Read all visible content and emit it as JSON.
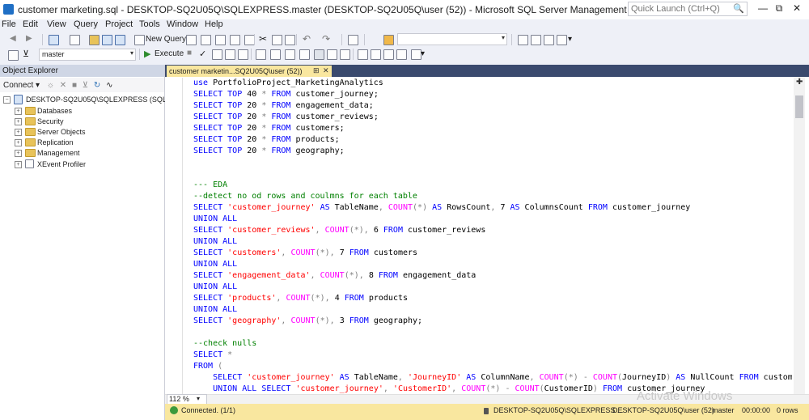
{
  "window": {
    "title": "customer marketing.sql - DESKTOP-SQ2U05Q\\SQLEXPRESS.master (DESKTOP-SQ2U05Q\\user (52)) - Microsoft SQL Server Management Studio",
    "quick_launch_placeholder": "Quick Launch (Ctrl+Q)"
  },
  "menu": [
    "File",
    "Edit",
    "View",
    "Query",
    "Project",
    "Tools",
    "Window",
    "Help"
  ],
  "toolbar": {
    "new_query_label": "New Query",
    "database_combo": "master",
    "execute_label": "Execute"
  },
  "object_explorer": {
    "title": "Object Explorer",
    "connect_label": "Connect",
    "server": "DESKTOP-SQ2U05Q\\SQLEXPRESS (SQL Serv",
    "nodes": [
      "Databases",
      "Security",
      "Server Objects",
      "Replication",
      "Management",
      "XEvent Profiler"
    ]
  },
  "editor": {
    "tab_label": "customer marketin...SQ2U05Q\\user (52))",
    "lines": [
      "use PortfolioProject_MarketingAnalytics",
      "SELECT TOP 40 * FROM customer_journey;",
      "SELECT TOP 20 * FROM engagement_data;",
      "SELECT TOP 20 * FROM customer_reviews;",
      "SELECT TOP 20 * FROM customers;",
      "SELECT TOP 20 * FROM products;",
      "SELECT TOP 20 * FROM geography;",
      "",
      "",
      "--- EDA",
      "--detect no od rows and coulmns for each table",
      "SELECT 'customer_journey' AS TableName, COUNT(*) AS RowsCount, 7 AS ColumnsCount FROM customer_journey",
      "UNION ALL",
      "SELECT 'customer_reviews', COUNT(*), 6 FROM customer_reviews",
      "UNION ALL",
      "SELECT 'customers', COUNT(*), 7 FROM customers",
      "UNION ALL",
      "SELECT 'engagement_data', COUNT(*), 8 FROM engagement_data",
      "UNION ALL",
      "SELECT 'products', COUNT(*), 4 FROM products",
      "UNION ALL",
      "SELECT 'geography', COUNT(*), 3 FROM geography;",
      "",
      "--check nulls",
      "SELECT *",
      "FROM (",
      "    SELECT 'customer_journey' AS TableName, 'JourneyID' AS ColumnName, COUNT(*) - COUNT(JourneyID) AS NullCount FROM customer_",
      "    UNION ALL SELECT 'customer_journey', 'CustomerID', COUNT(*) - COUNT(CustomerID) FROM customer_journey"
    ],
    "zoom": "112 %"
  },
  "watermark": "Activate Windows",
  "status": {
    "connection": "Connected. (1/1)",
    "server": "DESKTOP-SQ2U05Q\\SQLEXPRESS ...",
    "user": "DESKTOP-SQ2U05Q\\user (52)",
    "database": "master",
    "elapsed": "00:00:00",
    "rows": "0 rows"
  },
  "colors": {
    "keyword": "#0000ff",
    "string": "#ff0000",
    "function": "#ff00ff",
    "comment": "#008000",
    "status_bar": "#f9e79f",
    "tab_strip": "#3a4a6e"
  }
}
